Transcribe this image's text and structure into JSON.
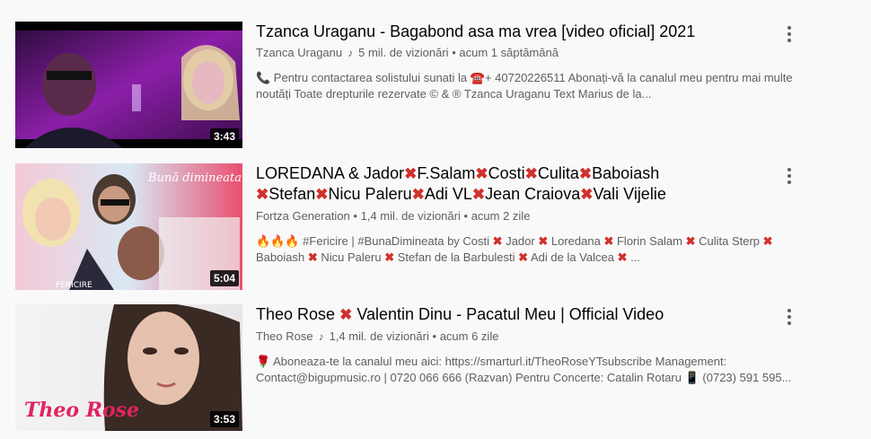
{
  "videos": [
    {
      "title": "Tzanca Uraganu - Bagabond asa ma vrea [video oficial] 2021",
      "channel": "Tzanca Uraganu",
      "channel_icon": "music-note-icon",
      "views": "5 mil. de vizionări",
      "age": "acum 1 săptămână",
      "duration": "3:43",
      "description": "📞 Pentru contactarea solistului sunati la ☎️+ 40720226511 Abonați-vă la canalul meu pentru mai multe noutăți Toate drepturile rezervate © & ® Tzanca Uraganu Text Marius de la..."
    },
    {
      "title_parts": [
        "LOREDANA & Jador",
        "F.Salam",
        "Costi",
        "Culita",
        "Baboiash",
        "Stefan",
        "Nicu Paleru",
        "Adi VL",
        "Jean Craiova",
        "Vali Vijelie"
      ],
      "channel": "Fortza Generation",
      "views": "1,4 mil. de vizionări",
      "age": "acum 2 zile",
      "duration": "5:04",
      "thumb_text": "Bună dimineata",
      "thumb_bottom_text": "FERICIRE",
      "desc_lead": "🔥🔥🔥 #Fericire | #BunaDimineata by Costi",
      "desc_parts": [
        "Jador",
        "Loredana",
        "Florin Salam",
        "Culita Sterp",
        "Baboiash",
        "Nicu Paleru",
        "Stefan de la Barbulesti",
        "Adi de la Valcea",
        "..."
      ]
    },
    {
      "title_a": "Theo Rose",
      "title_b": "Valentin Dinu - Pacatul Meu | Official Video",
      "channel": "Theo Rose",
      "channel_icon": "music-note-icon",
      "views": "1,4 mil. de vizionări",
      "age": "acum 6 zile",
      "duration": "3:53",
      "thumb_text": "Theo Rose",
      "description": "🌹 Aboneaza-te la canalul meu aici: https://smarturl.it/TheoRoseYTsubscribe Management: Contact@bigupmusic.ro | 0720 066 666 (Razvan) Pentru Concerte: Catalin Rotaru 📱 (0723) 591 595..."
    }
  ],
  "separator": "•",
  "cross_glyph": "✖",
  "colors": {
    "background": "#f9f9f9",
    "title": "#030303",
    "secondary": "#606060",
    "cross": "#d0312d"
  }
}
